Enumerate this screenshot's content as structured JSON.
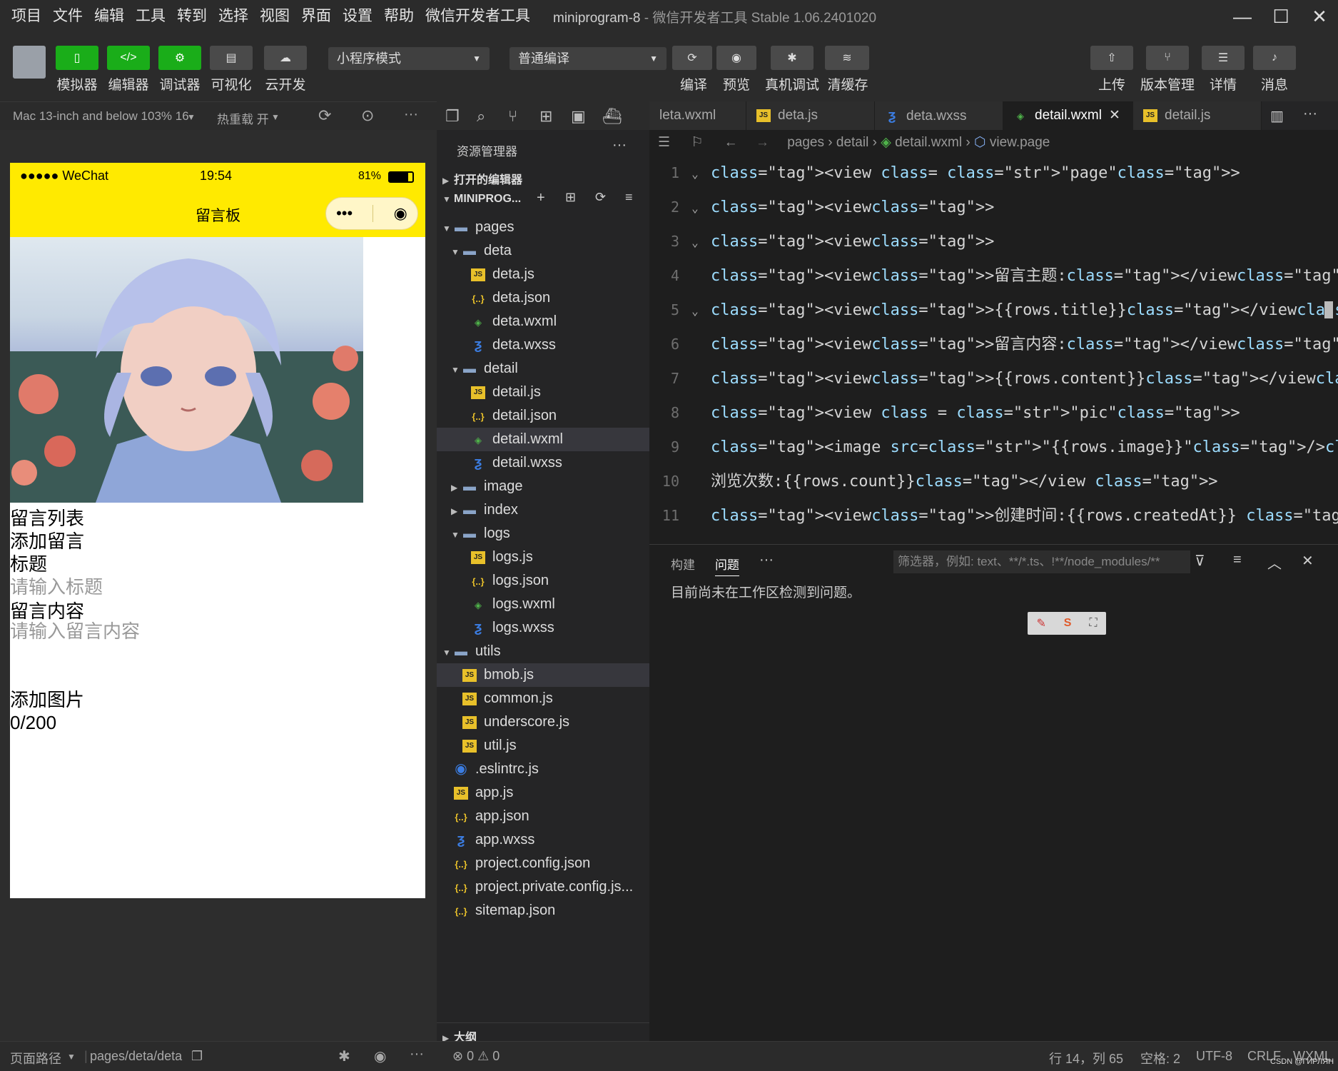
{
  "menu": {
    "items": [
      "项目",
      "文件",
      "编辑",
      "工具",
      "转到",
      "选择",
      "视图",
      "界面",
      "设置",
      "帮助",
      "微信开发者工具"
    ],
    "project": "miniprogram-8",
    "app_title": "微信开发者工具 Stable 1.06.2401020"
  },
  "toolbar": {
    "simulator": "模拟器",
    "editor": "编辑器",
    "debugger": "调试器",
    "visual": "可视化",
    "cloud": "云开发",
    "mode": "小程序模式",
    "compile_mode": "普通编译",
    "compile": "编译",
    "preview": "预览",
    "device_debug": "真机调试",
    "clear_cache": "清缓存",
    "upload": "上传",
    "version": "版本管理",
    "details": "详情",
    "messages": "消息"
  },
  "simbar": {
    "device": "Mac 13-inch and below 103% 16",
    "hotreload": "热重载 开"
  },
  "phone": {
    "carrier": "●●●●● WeChat",
    "time": "19:54",
    "battery": "81%",
    "title": "留言板",
    "lines": [
      "留言列表",
      "添加留言",
      "标题",
      "请输入标题",
      "留言内容",
      "请输入留言内容",
      "添加图片",
      "0/200"
    ]
  },
  "explorer": {
    "title": "资源管理器",
    "open_editors": "打开的编辑器",
    "project": "MINIPROG...",
    "items": [
      {
        "label": "pages",
        "type": "folder-open",
        "depth": 1
      },
      {
        "label": "deta",
        "type": "folder-open",
        "depth": 2
      },
      {
        "label": "deta.js",
        "type": "js",
        "depth": 3
      },
      {
        "label": "deta.json",
        "type": "json",
        "depth": 3
      },
      {
        "label": "deta.wxml",
        "type": "wxml",
        "depth": 3
      },
      {
        "label": "deta.wxss",
        "type": "wxss",
        "depth": 3
      },
      {
        "label": "detail",
        "type": "folder-open",
        "depth": 2
      },
      {
        "label": "detail.js",
        "type": "js",
        "depth": 3
      },
      {
        "label": "detail.json",
        "type": "json",
        "depth": 3
      },
      {
        "label": "detail.wxml",
        "type": "wxml",
        "depth": 3,
        "selected": true
      },
      {
        "label": "detail.wxss",
        "type": "wxss",
        "depth": 3
      },
      {
        "label": "image",
        "type": "folder",
        "depth": 2
      },
      {
        "label": "index",
        "type": "folder",
        "depth": 2
      },
      {
        "label": "logs",
        "type": "folder-open",
        "depth": 2
      },
      {
        "label": "logs.js",
        "type": "js",
        "depth": 3
      },
      {
        "label": "logs.json",
        "type": "json",
        "depth": 3
      },
      {
        "label": "logs.wxml",
        "type": "wxml",
        "depth": 3
      },
      {
        "label": "logs.wxss",
        "type": "wxss",
        "depth": 3
      },
      {
        "label": "utils",
        "type": "folder-open",
        "depth": 1
      },
      {
        "label": "bmob.js",
        "type": "js",
        "depth": 2,
        "selected": true
      },
      {
        "label": "common.js",
        "type": "js",
        "depth": 2
      },
      {
        "label": "underscore.js",
        "type": "js",
        "depth": 2
      },
      {
        "label": "util.js",
        "type": "js",
        "depth": 2
      },
      {
        "label": ".eslintrc.js",
        "type": "eslint",
        "depth": 1
      },
      {
        "label": "app.js",
        "type": "js",
        "depth": 1
      },
      {
        "label": "app.json",
        "type": "json",
        "depth": 1
      },
      {
        "label": "app.wxss",
        "type": "wxss",
        "depth": 1
      },
      {
        "label": "project.config.json",
        "type": "json",
        "depth": 1
      },
      {
        "label": "project.private.config.js...",
        "type": "json",
        "depth": 1
      },
      {
        "label": "sitemap.json",
        "type": "json",
        "depth": 1
      }
    ],
    "outline": "大纲"
  },
  "tabs": [
    "leta.wxml",
    "deta.js",
    "deta.wxss",
    "detail.wxml",
    "detail.js"
  ],
  "breadcrumb": [
    "pages",
    "detail",
    "detail.wxml",
    "view.page"
  ],
  "code": [
    "<view class= \"page\">",
    "<view>",
    "<view>",
    "<view>留言主题:</view>",
    "<view>{{rows.title}}</view><view>",
    "<view>留言内容:</view>",
    "<view>{{rows.content}}</view>",
    "<view class = \"pic\">",
    "<image  src=\"{{rows.image}}\"/></view><view>",
    "浏览次数:{{rows.count}}</view >",
    "<view>创建时间:{{rows.createdAt}} </view>"
  ],
  "panel": {
    "tab_build": "构建",
    "tab_problems": "问题",
    "filter_placeholder": "筛选器，例如: text、**/*.ts、!**/node_modules/**",
    "message": "目前尚未在工作区检测到问题。"
  },
  "status": {
    "page_path_label": "页面路径",
    "page_path": "pages/deta/deta",
    "errors": "0",
    "warnings": "0",
    "position": "行 14，列 65",
    "spaces": "空格: 2",
    "encoding": "UTF-8",
    "eol": "CRLF",
    "lang": "WXML",
    "watermark": "CSDN @ГИРЛЯН"
  }
}
